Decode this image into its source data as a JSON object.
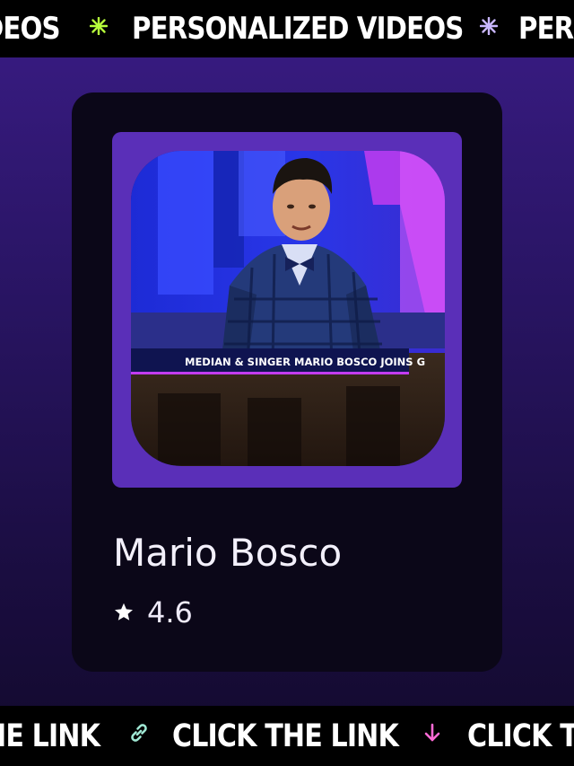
{
  "top_banner": {
    "items": [
      "DEOS",
      "PERSONALIZED VIDEOS",
      "PERS"
    ],
    "separator_icons": [
      "sparkle-icon",
      "sparkle-icon"
    ],
    "separator_colors": [
      "#b6ff3b",
      "#c9b6ff"
    ]
  },
  "bottom_banner": {
    "items": [
      "HE LINK",
      "CLICK THE LINK",
      "CLICK T"
    ],
    "separator_icons": [
      "link-icon",
      "arrow-down-icon"
    ],
    "separator_colors": [
      "#9fe7d3",
      "#ff6ad5"
    ]
  },
  "card": {
    "name": "Mario Bosco",
    "rating": "4.6",
    "photo": {
      "caption": "MEDIAN & SINGER MARIO BOSCO JOINS G"
    }
  },
  "colors": {
    "background": "#2a1566",
    "card": "#0b0718",
    "photo_frame": "#5a2fb8",
    "accent_lime": "#b6ff3b"
  }
}
